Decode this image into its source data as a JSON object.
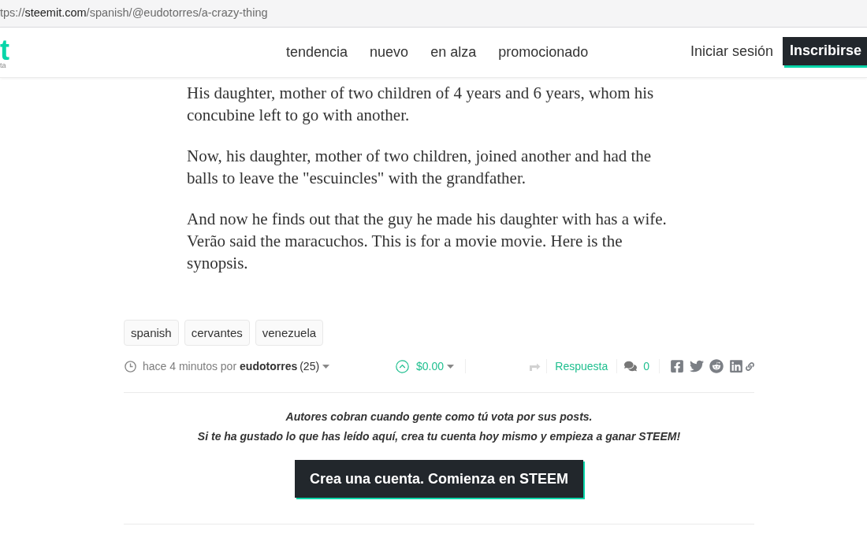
{
  "address_bar": {
    "url_scheme_part": "tps://",
    "url_host": "steemit.com",
    "url_path": "/spanish/@eudotorres/a-crazy-thing"
  },
  "header": {
    "logo": {
      "mark": "t",
      "tagline": "ta"
    },
    "nav": [
      "tendencia",
      "nuevo",
      "en alza",
      "promocionado"
    ],
    "sign_in": "Iniciar sesión",
    "sign_up": "Inscribirse"
  },
  "article": {
    "paragraphs": [
      "His daughter, mother of two children of 4 years and 6 years, whom his concubine left to go with another.",
      "Now, his daughter, mother of two children, joined another and had the balls to leave the \"escuincles\" with the grandfather.",
      "And now he finds out that the guy he made his daughter with has a wife. Verão said the maracuchos. This is for a movie movie. Here is the synopsis."
    ]
  },
  "tags": [
    "spanish",
    "cervantes",
    "venezuela"
  ],
  "post_footer": {
    "time": "hace 4 minutos por",
    "author": "eudotorres",
    "reputation": "(25)",
    "payout": "$0.00",
    "reply": "Respuesta",
    "comment_count": "0"
  },
  "signup_prompt": {
    "lines": [
      "Autores cobran cuando gente como tú vota por sus posts.",
      "Si te ha gustado lo que has leído aquí, crea tu cuenta hoy mismo y empieza a ganar STEEM!"
    ],
    "button": "Crea una cuenta. Comienza en STEEM"
  }
}
